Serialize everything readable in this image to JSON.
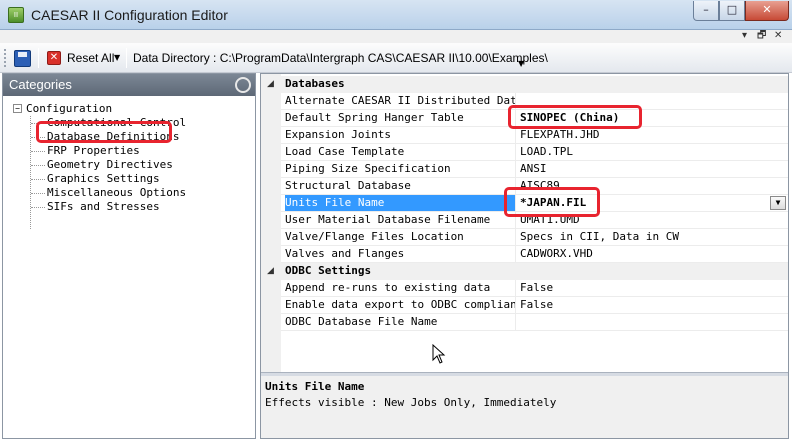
{
  "window": {
    "title": "CAESAR II Configuration Editor",
    "icon_label": "II",
    "min_glyph": "–",
    "max_glyph": "□",
    "close_glyph": "✕",
    "mdi_pin": "▾",
    "mdi_restore": "🗗",
    "mdi_close": "✕"
  },
  "toolbar": {
    "reset_icon_glyph": "✕",
    "reset_label": "Reset All",
    "reset_caret": "▼",
    "data_directory": "Data Directory : C:\\ProgramData\\Intergraph CAS\\CAESAR II\\10.00\\Examples\\",
    "overflow_caret": "▼"
  },
  "categories": {
    "header": "Categories",
    "root": "Configuration",
    "root_toggle": "−",
    "items": [
      "Computational Control",
      "Database Definitions",
      "FRP Properties",
      "Geometry Directives",
      "Graphics Settings",
      "Miscellaneous Options",
      "SIFs and Stresses"
    ]
  },
  "properties": {
    "groups": [
      {
        "name": "Databases",
        "toggle": "◢",
        "rows": [
          {
            "label": "Alternate CAESAR II Distributed Data P",
            "value": ""
          },
          {
            "label": "Default Spring Hanger Table",
            "value": "SINOPEC (China)"
          },
          {
            "label": "Expansion Joints",
            "value": "FLEXPATH.JHD"
          },
          {
            "label": "Load Case Template",
            "value": "LOAD.TPL"
          },
          {
            "label": "Piping Size Specification",
            "value": "ANSI"
          },
          {
            "label": "Structural Database",
            "value": "AISC89"
          },
          {
            "label": "Units File Name",
            "value": "*JAPAN.FIL"
          },
          {
            "label": "User Material Database Filename",
            "value": "UMAT1.UMD"
          },
          {
            "label": "Valve/Flange Files Location",
            "value": "Specs in CII, Data in CW"
          },
          {
            "label": "Valves and Flanges",
            "value": "CADWORX.VHD"
          }
        ]
      },
      {
        "name": "ODBC Settings",
        "toggle": "◢",
        "rows": [
          {
            "label": "Append re-runs to existing data",
            "value": "False"
          },
          {
            "label": "Enable data export to ODBC compliant d",
            "value": "False"
          },
          {
            "label": "ODBC Database File Name",
            "value": ""
          }
        ]
      }
    ],
    "dropdown_glyph": "▼"
  },
  "description": {
    "title": "Units File Name",
    "text": "Effects visible : New Jobs Only, Immediately"
  },
  "colors": {
    "highlight": "#e8242f",
    "selection": "#3399ff"
  }
}
